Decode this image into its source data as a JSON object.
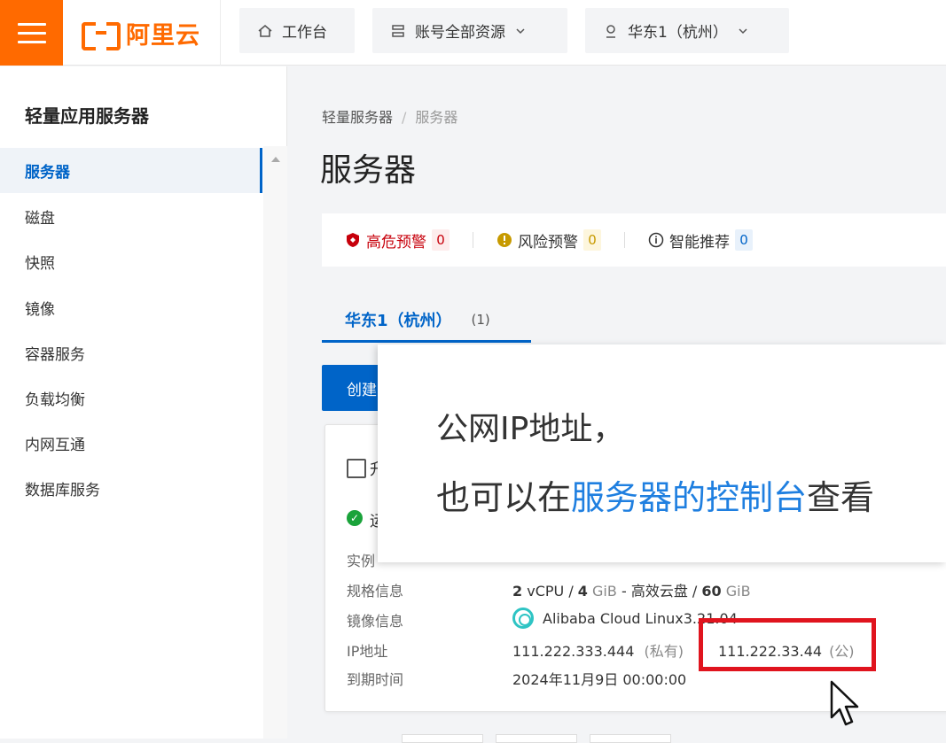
{
  "header": {
    "logo_text": "阿里云",
    "workbench": "工作台",
    "resources": "账号全部资源",
    "region": "华东1（杭州）"
  },
  "sidebar": {
    "title": "轻量应用服务器",
    "items": [
      {
        "label": "服务器",
        "active": true
      },
      {
        "label": "磁盘"
      },
      {
        "label": "快照"
      },
      {
        "label": "镜像"
      },
      {
        "label": "容器服务"
      },
      {
        "label": "负载均衡"
      },
      {
        "label": "内网互通"
      },
      {
        "label": "数据库服务"
      }
    ]
  },
  "main": {
    "breadcrumb": [
      "轻量服务器",
      "服务器"
    ],
    "title": "服务器",
    "alerts": [
      {
        "label": "高危预警",
        "count": "0",
        "color": "#c7000b"
      },
      {
        "label": "风险预警",
        "count": "0",
        "color": "#c79a00"
      },
      {
        "label": "智能推荐",
        "count": "0",
        "color": "#333333"
      }
    ],
    "tab": {
      "label": "华东1（杭州）",
      "count": "(1)"
    },
    "create_label": "创建",
    "card": {
      "check_text": "升",
      "status": "运",
      "labels": [
        "实例",
        "规格信息",
        "镜像信息",
        "IP地址",
        "到期时间"
      ],
      "spec": {
        "cpu": "2",
        "cpu_unit": "vCPU",
        "mem": "4",
        "mem_unit": "GiB",
        "disk": "高效云盘",
        "disk_size": "60",
        "disk_unit": "GiB"
      },
      "image": "Alibaba Cloud Linux3.21.04",
      "private_ip": "111.222.333.444",
      "private_tag": "(私有)",
      "public_ip": "111.222.33.44",
      "public_tag": "(公)",
      "expiry": "2024年11月9日 00:00:00"
    }
  },
  "overlay": {
    "line1": "公网IP地址，",
    "line2_pre": "也可以在",
    "line2_accent": "服务器的控制台",
    "line2_post": "查看"
  },
  "colors": {
    "brand": "#ff6a00",
    "primary": "#0064c8",
    "highlight": "#e0141e",
    "accent": "#1f7fe0"
  }
}
